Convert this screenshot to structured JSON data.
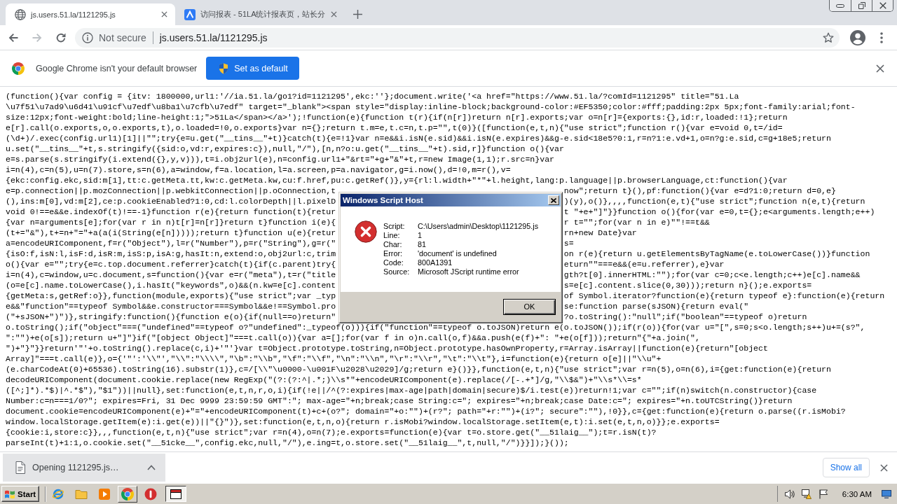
{
  "browser": {
    "tabs": [
      {
        "title": "js.users.51.la/1121295.js",
        "selected": true
      },
      {
        "title": "访问报表 - 51LA统计报表页，站长分",
        "selected": false
      }
    ],
    "nav_buttons": [
      {
        "kind": "back",
        "disabled": false
      },
      {
        "kind": "forward",
        "disabled": true
      },
      {
        "kind": "reload",
        "disabled": false
      }
    ],
    "address_bar": {
      "security": "Not secure",
      "url": "js.users.51.la/1121295.js"
    },
    "infobar": {
      "message": "Google Chrome isn't your default browser",
      "button": "Set as default"
    }
  },
  "page": {
    "lines": [
      {
        "text": "(function(){var config = {itv: 1800000,url1:'//ia.51.la/go1?id=1121295',ekc:''};document.write('<a href=\"https://www.51.la/?comId=1121295\" title=\"51.La"
      },
      {
        "text": "\\u7f51\\u7ad9\\u6d41\\u91cf\\u7edf\\u8ba1\\u7cfb\\u7edf\" target=\"_blank\"><span style=\"display:inline-block;background-color:#EF5350;color:#fff;padding:2px 5px;font-family:arial;font-"
      },
      {
        "text": "size:12px;font-weight:bold;line-height:1;\">51La</span></a>');!function(e){function t(r){if(n[r])return n[r].exports;var o=n[r]={exports:{},id:r,loaded:!1};return"
      },
      {
        "text": "e[r].call(o.exports,o,o.exports,t),o.loaded=!0,o.exports}var n={};return t.m=e,t.c=n,t.p=\"\",t(0)}([function(e,t,n){\"use strict\";function r(){var e=void 0,t=/id="
      },
      {
        "text": "(\\d+)/.exec(config.url1)[1]||\"\";try{e=u.get(\"__tins__\"+t)}catch(t){e=!1}var n=e&&i.isN(e.sid)&&i.isN(e.expires)&&g-e.sid<18e5?0:1,r=n?1:e.vd+1,o=n?g:e.sid,c=g+18e5;return"
      },
      {
        "text": "u.set(\"__tins__\"+t,s.stringify({sid:o,vd:r,expires:c}),null,\"/\"),[n,n?o:u.get(\"__tins__\"+t).sid,r]}function o(){var"
      },
      {
        "text": "e=s.parse(s.stringify(i.extend({},y,v))),t=i.obj2url(e),n=config.url1+\"&rt=\"+g+\"&\"+t,r=new Image(1,1);r.src=n}var"
      },
      {
        "text": "i=n(4),c=n(5),u=n(7).store,s=n(6),a=window,f=a.location,l=a.screen,p=a.navigator,g=i.now(),d=!0,m=r(),v="
      },
      {
        "text": "{ekc:config.ekc,sid:m[1],tt:c.getMeta.tt,kw:c.getMeta.kw,cu:f.href,pu:c.getRef()},y={rl:l.width+\"*\"+l.height,lang:p.language||p.browserLanguage,ct:function(){var"
      },
      {
        "left": "e=p.connection||p.mozConnection||p.webkitConnection||p.oConnection,t",
        "right": "now\";return t}(),pf:function(){var e=d?1:0;return d=0,e}"
      },
      {
        "left": "(),ins:m[0],vd:m[2],ce:p.cookieEnabled?1:0,cd:l.colorDepth||l.pixelD",
        "right": ")(y),o()},,,,function(e,t){\"use strict\";function n(e,t){return"
      },
      {
        "left": "void 0!==e&&e.indexOf(t)!==-1}function r(e){return function(t){retur",
        "right": "t \"+e+\"]\"}}function o(){for(var e=0,t={};e<arguments.length;e++)"
      },
      {
        "left": "{var n=arguments[e];for(var r in n)t[r]=n[r]}return t}function i(e){",
        "right": "r t=\"\";for(var n in e)\"\"!==t&&"
      },
      {
        "left": "(t+=\"&\"),t+=n+\"=\"+a(a(i(String(e[n]))));return t}function u(e){retur",
        "right": "rn+new Date}var"
      },
      {
        "left": "a=encodeURIComponent,f=r(\"Object\"),l=r(\"Number\"),p=r(\"String\"),g=r(\"",
        "right": "s="
      },
      {
        "left": "{isO:f,isN:l,isF:d,isR:m,isS:p,isA:g,hasIt:n,extend:o,obj2url:c,trim",
        "right": "on r(e){return u.getElementsByTagName(e.toLowerCase())}function"
      },
      {
        "left": "o(){var e=\"\";try{e=c.top.document.referrer}catch(t){if(c.parent)try{",
        "right": "eturn\"\"===e&&(e=u.referrer),e}var"
      },
      {
        "left": "i=n(4),c=window,u=c.document,s=function(){var e=r(\"meta\"),t=r(\"title",
        "right": "gth?t[0].innerHTML:\"\");for(var c=0;c<e.length;c++)e[c].name&&"
      },
      {
        "left": "(o=e[c].name.toLowerCase(),i.hasIt(\"keywords\",o)&&(n.kw=e[c].content",
        "right": "s=e[c].content.slice(0,30)));return n}();e.exports="
      },
      {
        "left": "{getMeta:s,getRef:o}},function(module,exports){\"use strict\";var _typ",
        "right": "of Symbol.iterator?function(e){return typeof e}:function(e){return"
      },
      {
        "left": "e&&\"function\"==typeof Symbol&&e.constructor===Symbol&&e!==Symbol.pro",
        "right": "se:function parse(sJSON){return eval(\""
      },
      {
        "left": "(\"+sJSON+\")\")},stringify:function(){function e(o){if(null==o)return\"",
        "right": "?o.toString():\"null\";if(\"boolean\"==typeof o)return"
      },
      {
        "text": "o.toString();if(\"object\"===(\"undefined\"==typeof o?\"undefined\":_typeof(o))){if(\"function\"==typeof o.toJSON)return e(o.toJSON());if(r(o)){for(var u=\"[\",s=0;s<o.length;s++)u+=(s?\","
      },
      {
        "text": "\":\"\")+e(o[s]);return u+\"]\"}if(\"[object Object]\"===t.call(o)){var a=[];for(var f in o)n.call(o,f)&&a.push(e(f)+\": \"+e(o[f]));return\"{\"+a.join(\","
      },
      {
        "text": "\")+\"}\"}}return'\"'+o.toString().replace(c,i)+'\"'}var t=Object.prototype.toString,n=Object.prototype.hasOwnProperty,r=Array.isArray||function(e){return\"[object"
      },
      {
        "text": "Array]\"===t.call(e)},o={'\"':'\\\\\"',\"\\\\\":\"\\\\\\\\\",\"\\b\":\"\\\\b\",\"\\f\":\"\\\\f\",\"\\n\":\"\\\\n\",\"\\r\":\"\\\\r\",\"\\t\":\"\\\\t\"},i=function(e){return o[e]||\"\\\\u\"+"
      },
      {
        "text": "(e.charCodeAt(0)+65536).toString(16).substr(1)},c=/[\\\\\"\\u0000-\\u001F\\u2028\\u2029]/g;return e}()}},function(e,t,n){\"use strict\";var r=n(5),o=n(6),i={get:function(e){return"
      },
      {
        "text": "decodeURIComponent(document.cookie.replace(new RegExp(\"(?:(?:^|.*;)\\\\s*\"+encodeURIComponent(e).replace(/[-.+*]/g,\"\\\\$&\")+\"\\\\s*\\\\=s*"
      },
      {
        "text": "([^;]*).*$)|^.*$\"),\"$1\"))||null},set:function(e,t,n,r,o,i){if(!e||/^(?:expires|max-age|path|domain|secure)$/i.test(e))return!1;var c=\"\";if(n)switch(n.constructor){case"
      },
      {
        "text": "Number:c=n===1/0?\"; expires=Fri, 31 Dec 9999 23:59:59 GMT\":\"; max-age=\"+n;break;case String:c=\"; expires=\"+n;break;case Date:c=\"; expires=\"+n.toUTCString()}return"
      },
      {
        "text": "document.cookie=encodeURIComponent(e)+\"=\"+encodeURIComponent(t)+c+(o?\"; domain=\"+o:\"\")+(r?\"; path=\"+r:\"\")+(i?\"; secure\":\"\"),!0}},c={get:function(e){return o.parse((r.isMobi?"
      },
      {
        "text": "window.localStorage.getItem(e):i.get(e))||\"{}\")},set:function(e,t,n,o){return r.isMobi?window.localStorage.setItem(e,t):i.set(e,t,n,o)}};e.exports="
      },
      {
        "text": "{cookie:i,store:c}},,,function(e,t,n){\"use strict\";var r=n(4),o=n(7);e.exports=function(e){var t=o.store.get(\"__51laig__\");t=r.isN(t)?"
      },
      {
        "text": "parseInt(t)+1:1,o.cookie.set(\"__51cke__\",config.ekc,null,\"/\"),e.ing=t,o.store.set(\"__51laig__\",t,null,\"/\")}}]);}());"
      }
    ]
  },
  "dialog": {
    "title": "Windows Script Host",
    "fields": [
      {
        "label": "Script:",
        "value": "C:\\Users\\admin\\Desktop\\1121295.js"
      },
      {
        "label": "Line:",
        "value": "1"
      },
      {
        "label": "Char:",
        "value": "81"
      },
      {
        "label": "Error:",
        "value": "'document' is undefined"
      },
      {
        "label": "Code:",
        "value": "800A1391"
      },
      {
        "label": "Source:",
        "value": "Microsoft JScript runtime error"
      }
    ],
    "button": "OK"
  },
  "download_bar": {
    "item": "Opening 1121295.js…",
    "button": "Show all"
  },
  "taskbar": {
    "start": "Start",
    "clock": "6:30 AM"
  }
}
